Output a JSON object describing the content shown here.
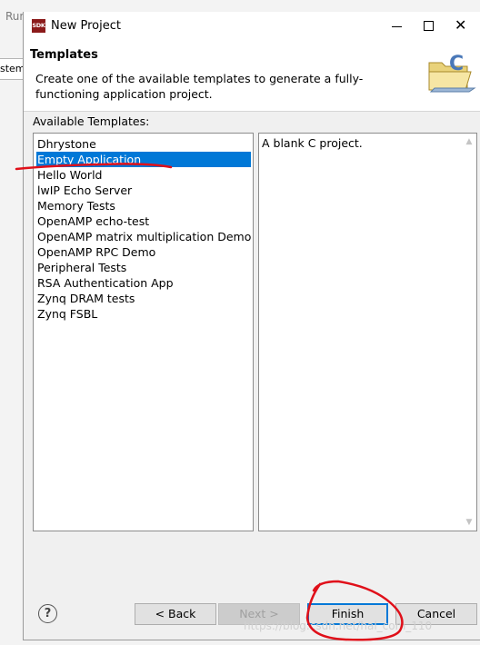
{
  "background": {
    "run_label": "Run",
    "side_text": "stem"
  },
  "window": {
    "title": "New Project",
    "icon_text": "SDK"
  },
  "header": {
    "title": "Templates",
    "description": "Create one of the available templates to generate a fully-functioning application project."
  },
  "templates": {
    "label": "Available Templates:",
    "items": [
      "Dhrystone",
      "Empty Application",
      "Hello World",
      "lwIP Echo Server",
      "Memory Tests",
      "OpenAMP echo-test",
      "OpenAMP matrix multiplication Demo",
      "OpenAMP RPC Demo",
      "Peripheral Tests",
      "RSA Authentication App",
      "Zynq DRAM tests",
      "Zynq FSBL"
    ],
    "selected": "Empty Application"
  },
  "description_panel": {
    "text": "A blank C project."
  },
  "buttons": {
    "help": "?",
    "back": "< Back",
    "next": "Next >",
    "finish": "Finish",
    "cancel": "Cancel"
  },
  "watermark": "https://blog.csdn.net/hal_com_110",
  "colors": {
    "selection": "#0078d7",
    "annotation": "#e0101a",
    "dialog_bg": "#f0f0f0"
  }
}
